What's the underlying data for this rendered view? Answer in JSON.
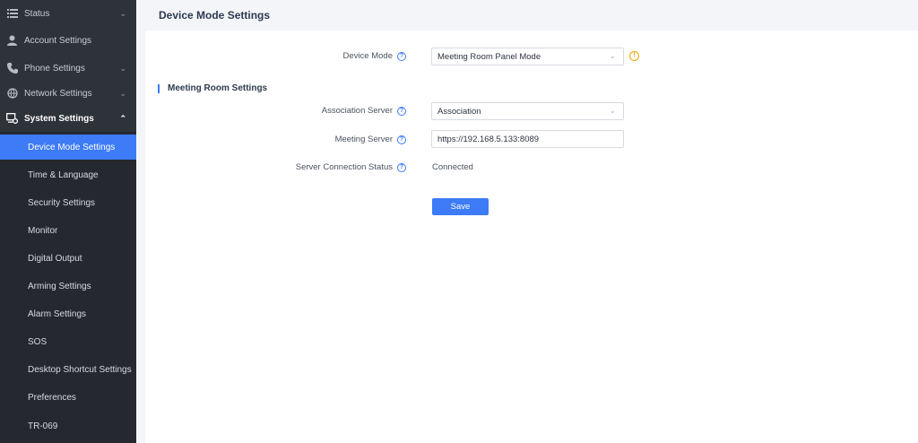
{
  "sidebar": {
    "menu": [
      {
        "label": "Status",
        "icon": "list-icon",
        "has_chevron": true,
        "chevron": "down"
      },
      {
        "label": "Account Settings",
        "icon": "user-icon",
        "has_chevron": false
      },
      {
        "label": "Phone Settings",
        "icon": "phone-icon",
        "has_chevron": true,
        "chevron": "down"
      },
      {
        "label": "Network Settings",
        "icon": "network-icon",
        "has_chevron": true,
        "chevron": "down"
      },
      {
        "label": "System Settings",
        "icon": "system-icon",
        "has_chevron": true,
        "chevron": "up"
      }
    ],
    "submenu": [
      {
        "label": "Device Mode Settings",
        "active": true
      },
      {
        "label": "Time & Language",
        "active": false
      },
      {
        "label": "Security Settings",
        "active": false
      },
      {
        "label": "Monitor",
        "active": false
      },
      {
        "label": "Digital Output",
        "active": false
      },
      {
        "label": "Arming Settings",
        "active": false
      },
      {
        "label": "Alarm Settings",
        "active": false
      },
      {
        "label": "SOS",
        "active": false
      },
      {
        "label": "Desktop Shortcut Settings",
        "active": false
      },
      {
        "label": "Preferences",
        "active": false
      },
      {
        "label": "TR-069",
        "active": false
      }
    ]
  },
  "header": {
    "title": "Device Mode Settings"
  },
  "form": {
    "device_mode": {
      "label": "Device Mode",
      "value": "Meeting Room Panel Mode"
    },
    "section_title": "Meeting Room Settings",
    "association_server": {
      "label": "Association Server",
      "value": "Association"
    },
    "meeting_server": {
      "label": "Meeting Server",
      "value": "https://192.168.5.133:8089"
    },
    "connection_status": {
      "label": "Server Connection Status",
      "value": "Connected"
    },
    "save_label": "Save"
  },
  "colors": {
    "accent": "#3d7bf7",
    "sidebar": "#2e3239",
    "warning": "#f0a70a"
  }
}
